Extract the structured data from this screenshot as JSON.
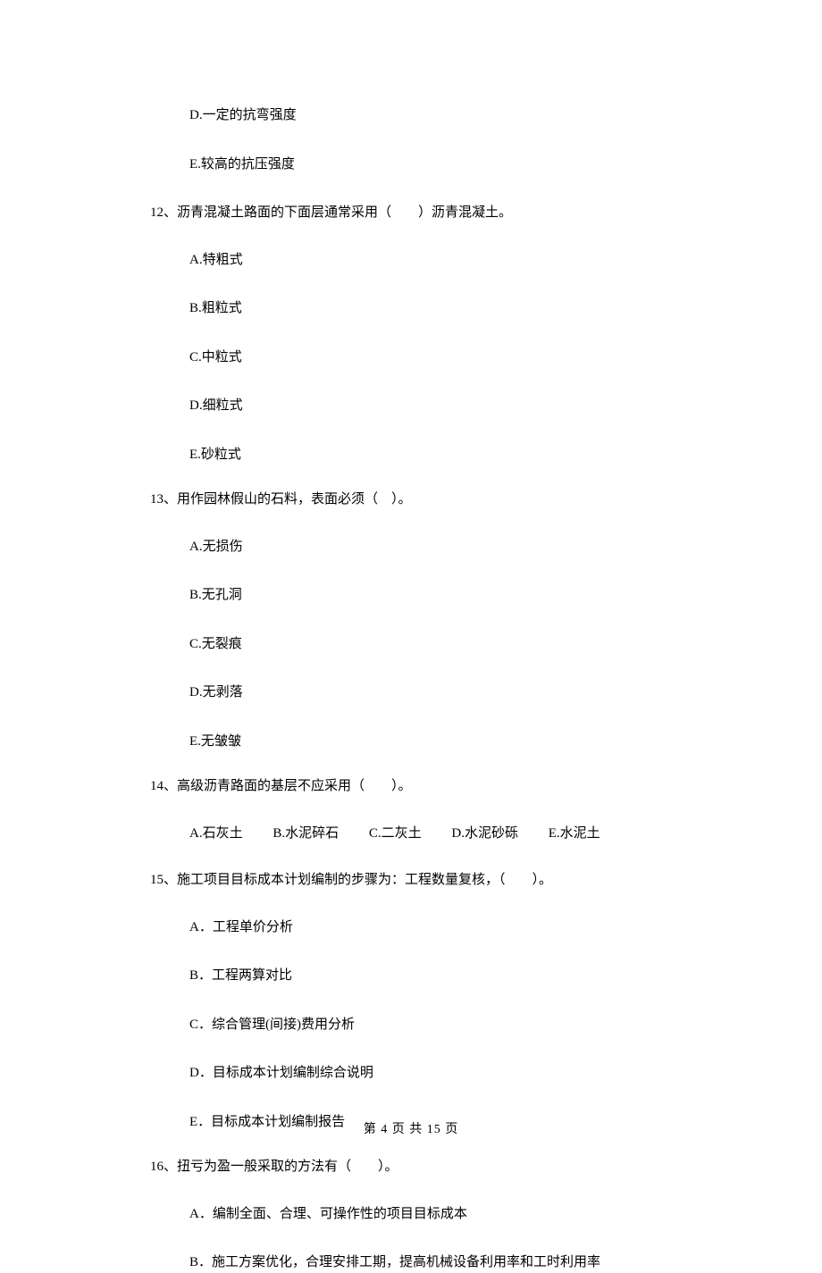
{
  "continued_options": {
    "d": "D.一定的抗弯强度",
    "e": "E.较高的抗压强度"
  },
  "questions": [
    {
      "number": "12、",
      "text": "沥青混凝土路面的下面层通常采用（　　）沥青混凝土。",
      "options": {
        "a": "A.特粗式",
        "b": "B.粗粒式",
        "c": "C.中粒式",
        "d": "D.细粒式",
        "e": "E.砂粒式"
      }
    },
    {
      "number": "13、",
      "text": "用作园林假山的石料，表面必须（　）。",
      "options": {
        "a": "A.无损伤",
        "b": "B.无孔洞",
        "c": "C.无裂痕",
        "d": "D.无剥落",
        "e": "E.无皱皱"
      }
    },
    {
      "number": "14、",
      "text": "高级沥青路面的基层不应采用（　　）。",
      "inline_options": {
        "a": "A.石灰土",
        "b": "B.水泥碎石",
        "c": "C.二灰土",
        "d": "D.水泥砂砾",
        "e": "E.水泥土"
      }
    },
    {
      "number": "15、",
      "text": "施工项目目标成本计划编制的步骤为：工程数量复核，（　　）。",
      "options": {
        "a": "A．工程单价分析",
        "b": "B．工程两算对比",
        "c": "C．综合管理(间接)费用分析",
        "d": "D．目标成本计划编制综合说明",
        "e": "E．目标成本计划编制报告"
      }
    },
    {
      "number": "16、",
      "text": "扭亏为盈一般采取的方法有（　　）。",
      "options_partial": {
        "a": "A．编制全面、合理、可操作性的项目目标成本",
        "b": "B．施工方案优化，合理安排工期，提高机械设备利用率和工时利用率"
      }
    }
  ],
  "footer": "第 4 页 共 15 页"
}
